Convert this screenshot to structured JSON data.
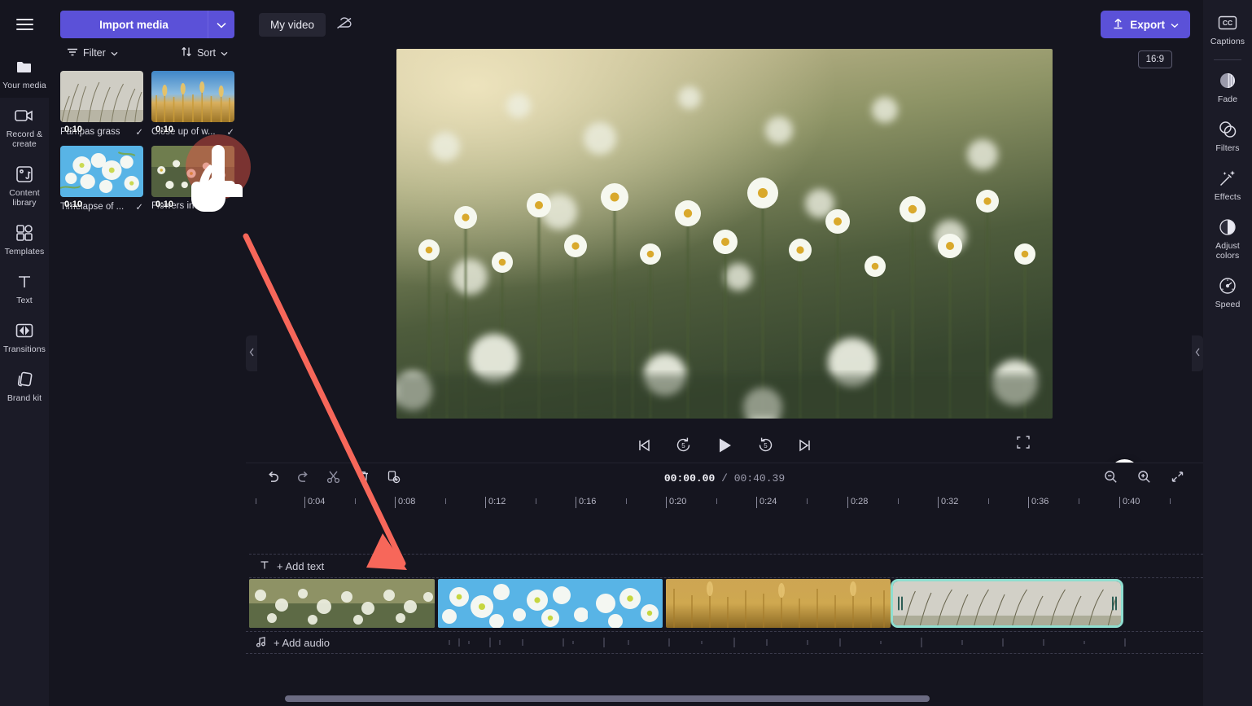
{
  "app": {
    "name": "Clipchamp Video Editor"
  },
  "left_rail": {
    "menu_icon": "hamburger-icon",
    "items": [
      {
        "label": "Your media",
        "icon": "folder-icon",
        "active": true
      },
      {
        "label": "Record & create",
        "icon": "video-camera-icon",
        "active": false
      },
      {
        "label": "Content library",
        "icon": "content-library-icon",
        "active": false
      },
      {
        "label": "Templates",
        "icon": "templates-icon",
        "active": false
      },
      {
        "label": "Text",
        "icon": "text-icon",
        "active": false
      },
      {
        "label": "Transitions",
        "icon": "transitions-icon",
        "active": false
      },
      {
        "label": "Brand kit",
        "icon": "brand-kit-icon",
        "active": false
      }
    ]
  },
  "media_panel": {
    "import_label": "Import media",
    "import_caret_icon": "chevron-down-icon",
    "filter_label": "Filter",
    "filter_icon": "filter-icon",
    "sort_label": "Sort",
    "sort_icon": "sort-arrows-icon",
    "items": [
      {
        "title": "Pampas grass",
        "duration": "0:10",
        "checked": "✓",
        "thumb": "pampas-grass"
      },
      {
        "title": "Close up of w...",
        "duration": "0:10",
        "checked": "✓",
        "thumb": "wheat"
      },
      {
        "title": "Timelapse of ...",
        "duration": "0:10",
        "checked": "✓",
        "thumb": "blossom"
      },
      {
        "title": "Flowers in me",
        "duration": "0:10",
        "checked": "",
        "thumb": "daisies"
      }
    ]
  },
  "header": {
    "project_title": "My video",
    "cloud_icon": "cloud-off-icon",
    "export_label": "Export",
    "export_icon": "upload-icon",
    "export_caret_icon": "chevron-down-icon",
    "export_color": "#5b51d8"
  },
  "preview": {
    "aspect_ratio": "16:9",
    "scene": "daisy-field",
    "controls": [
      {
        "name": "skip-to-start-button",
        "icon": "skip-back-icon"
      },
      {
        "name": "rewind-5-button",
        "icon": "rewind-5-icon"
      },
      {
        "name": "play-button",
        "icon": "play-icon"
      },
      {
        "name": "forward-5-button",
        "icon": "forward-5-icon"
      },
      {
        "name": "skip-to-end-button",
        "icon": "skip-forward-icon"
      }
    ],
    "fullscreen_icon": "fullscreen-icon",
    "help_label": "?",
    "collapse_icon": "chevron-down-icon",
    "left_handle_icon": "chevron-left-icon",
    "right_handle_icon": "chevron-left-icon"
  },
  "timeline": {
    "tools": [
      {
        "name": "undo-button",
        "icon": "undo-icon"
      },
      {
        "name": "redo-button",
        "icon": "redo-icon"
      },
      {
        "name": "split-button",
        "icon": "scissors-icon"
      },
      {
        "name": "delete-button",
        "icon": "trash-icon"
      },
      {
        "name": "duplicate-button",
        "icon": "duplicate-icon"
      }
    ],
    "current_time": "00:00.00",
    "separator": "/",
    "total_time": "00:40.39",
    "zoom_tools": [
      {
        "name": "zoom-out-button",
        "icon": "zoom-out-icon"
      },
      {
        "name": "zoom-in-button",
        "icon": "zoom-in-icon"
      },
      {
        "name": "fit-to-screen-button",
        "icon": "fit-screen-icon"
      }
    ],
    "ruler_labels": [
      "0:04",
      "0:08",
      "0:12",
      "0:16",
      "0:20",
      "0:24",
      "0:28",
      "0:32",
      "0:36",
      "0:40"
    ],
    "add_text_label": "+ Add text",
    "add_text_icon": "text-icon",
    "add_audio_label": "+ Add audio",
    "add_audio_icon": "music-note-icon",
    "clips": [
      {
        "name": "clip-daisies",
        "thumb": "daisies",
        "selected": false
      },
      {
        "name": "clip-blossom",
        "thumb": "blossom",
        "selected": false
      },
      {
        "name": "clip-wheat",
        "thumb": "wheat",
        "selected": false
      },
      {
        "name": "clip-pampas-grass",
        "thumb": "pampas",
        "selected": true
      }
    ],
    "selection_color": "#8fded0"
  },
  "right_rail": {
    "items": [
      {
        "label": "Captions",
        "icon": "captions-icon",
        "separator_after": true
      },
      {
        "label": "Fade",
        "icon": "fade-icon",
        "separator_after": false
      },
      {
        "label": "Filters",
        "icon": "filters-icon",
        "separator_after": false
      },
      {
        "label": "Effects",
        "icon": "effects-wand-icon",
        "separator_after": false
      },
      {
        "label": "Adjust colors",
        "icon": "adjust-colors-icon",
        "separator_after": false
      },
      {
        "label": "Speed",
        "icon": "speedometer-icon",
        "separator_after": false
      }
    ]
  },
  "annotation": {
    "cursor_icon": "hand-pointer-cursor",
    "arrow_color": "#f7675a",
    "highlight_color": "rgba(224,82,68,0.55)"
  }
}
